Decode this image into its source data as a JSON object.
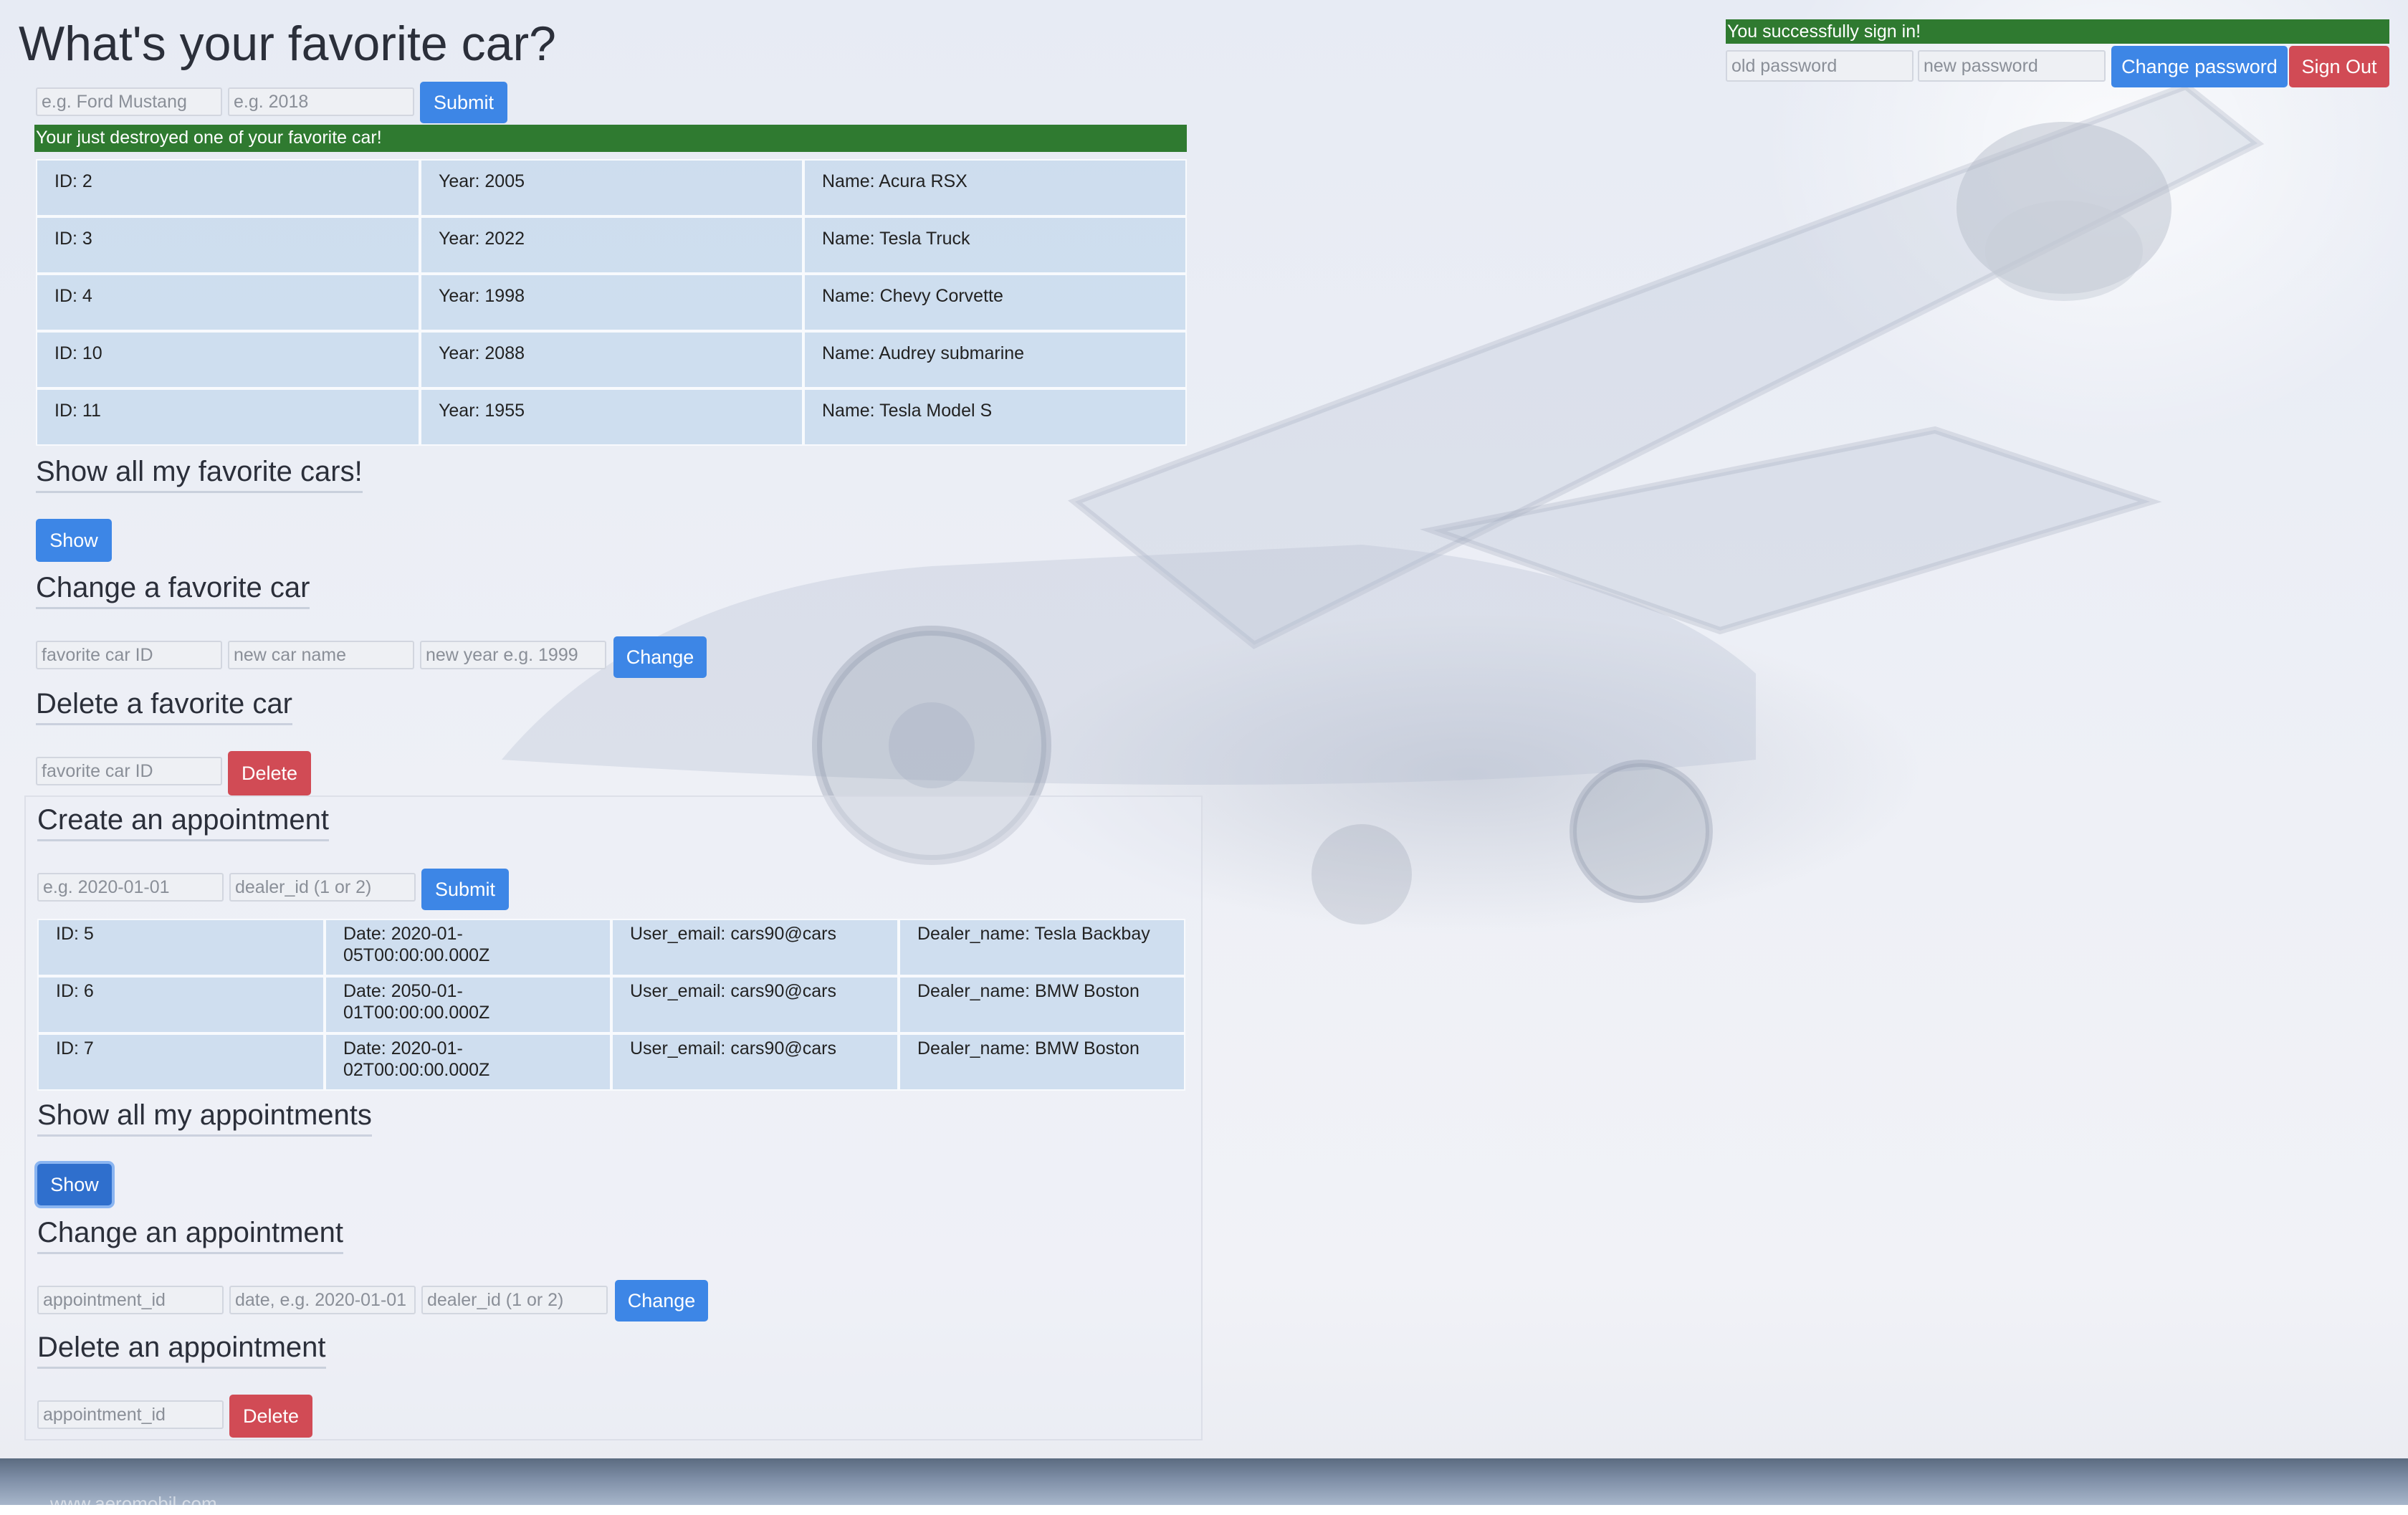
{
  "page": {
    "title": "What's your favorite car?"
  },
  "auth": {
    "banner": "You successfully sign in!",
    "old_password_placeholder": "old password",
    "new_password_placeholder": "new password",
    "change_password_label": "Change password",
    "sign_out_label": "Sign Out"
  },
  "add_car": {
    "name_placeholder": "e.g. Ford Mustang",
    "year_placeholder": "e.g. 2018",
    "submit_label": "Submit",
    "banner": "Your just destroyed one of your favorite car!"
  },
  "cars": [
    {
      "id": "ID: 2",
      "year": "Year: 2005",
      "name": "Name: Acura RSX"
    },
    {
      "id": "ID: 3",
      "year": "Year: 2022",
      "name": "Name: Tesla Truck"
    },
    {
      "id": "ID: 4",
      "year": "Year: 1998",
      "name": "Name: Chevy Corvette"
    },
    {
      "id": "ID: 10",
      "year": "Year: 2088",
      "name": "Name: Audrey submarine"
    },
    {
      "id": "ID: 11",
      "year": "Year: 1955",
      "name": "Name: Tesla Model S"
    }
  ],
  "show_cars": {
    "title": "Show all my favorite cars!",
    "button": "Show"
  },
  "change_car": {
    "title": "Change a favorite car",
    "id_placeholder": "favorite car ID",
    "name_placeholder": "new car name",
    "year_placeholder": "new year e.g. 1999",
    "button": "Change"
  },
  "delete_car": {
    "title": "Delete a favorite car",
    "id_placeholder": "favorite car ID",
    "button": "Delete"
  },
  "create_appointment": {
    "title": "Create an appointment",
    "date_placeholder": "e.g. 2020-01-01",
    "dealer_placeholder": "dealer_id (1 or 2)",
    "button": "Submit"
  },
  "appointments": [
    {
      "id": "ID: 5",
      "date_line1": "Date: 2020-01-",
      "date_line2": "05T00:00:00.000Z",
      "email": "User_email: cars90@cars",
      "dealer": "Dealer_name: Tesla Backbay"
    },
    {
      "id": "ID: 6",
      "date_line1": "Date: 2050-01-",
      "date_line2": "01T00:00:00.000Z",
      "email": "User_email: cars90@cars",
      "dealer": "Dealer_name: BMW Boston"
    },
    {
      "id": "ID: 7",
      "date_line1": "Date: 2020-01-",
      "date_line2": "02T00:00:00.000Z",
      "email": "User_email: cars90@cars",
      "dealer": "Dealer_name: BMW Boston"
    }
  ],
  "show_appointments": {
    "title": "Show all my appointments",
    "button": "Show"
  },
  "change_appointment": {
    "title": "Change an appointment",
    "id_placeholder": "appointment_id",
    "date_placeholder": "date, e.g. 2020-01-01",
    "dealer_placeholder": "dealer_id (1 or 2)",
    "button": "Change"
  },
  "delete_appointment": {
    "title": "Delete an appointment",
    "id_placeholder": "appointment_id",
    "button": "Delete"
  },
  "footer": {
    "watermark": "www.aeromobil.com"
  },
  "colors": {
    "primary_button": "#3d86e6",
    "danger_button": "#d14b55",
    "success_banner": "#2f7a30",
    "table_cell": "#c4d8ec"
  }
}
